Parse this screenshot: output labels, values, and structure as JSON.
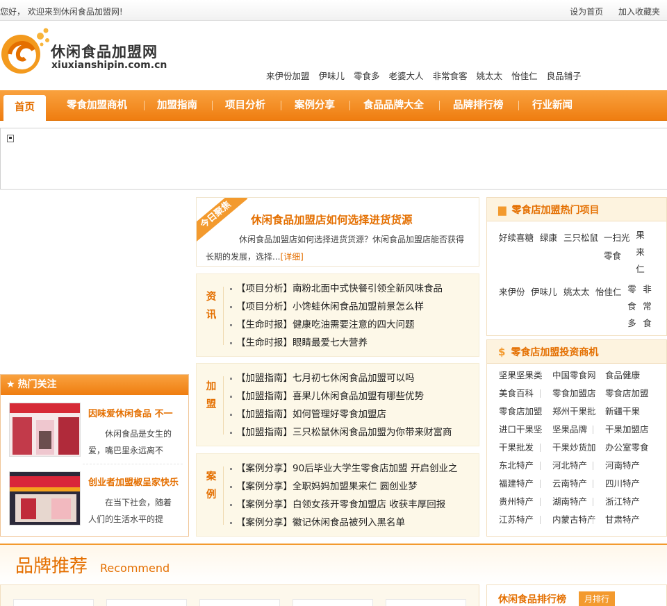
{
  "topbar": {
    "welcome": "您好， 欢迎来到休闲食品加盟网!",
    "set_home": "设为首页",
    "add_favorite": "加入收藏夹"
  },
  "logo": {
    "name": "休闲食品加盟网",
    "domain": "xiuxianshipin.com.cn"
  },
  "hot_brands": [
    "来伊份加盟",
    "伊味儿",
    "零食多",
    "老婆大人",
    "非常食客",
    "姚太太",
    "怡佳仁",
    "良品铺子"
  ],
  "nav": [
    "首页",
    "零食加盟商机",
    "加盟指南",
    "项目分析",
    "案例分享",
    "食品品牌大全",
    "品牌排行榜",
    "行业新闻"
  ],
  "focus": {
    "ribbon": "今日聚焦",
    "title": "休闲食品加盟店如何选择进货货源",
    "desc": "休闲食品加盟店如何选择进货货源？休闲食品加盟店能否获得长期的发展，选择...",
    "more": "[详细]"
  },
  "news_blocks": [
    {
      "category": "资讯",
      "items": [
        "【项目分析】南粉北面中式快餐引领全新风味食品",
        "【项目分析】小馋蛙休闲食品加盟前景怎么样",
        "【生命时报】健康吃油需要注意的四大问题",
        "【生命时报】眼睛最爱七大营养"
      ]
    },
    {
      "category": "加盟",
      "items": [
        "【加盟指南】七月初七休闲食品加盟可以吗",
        "【加盟指南】喜果儿休闲食品加盟有哪些优势",
        "【加盟指南】如何管理好零食加盟店",
        "【加盟指南】三只松鼠休闲食品加盟为你带来财富商"
      ]
    },
    {
      "category": "案例",
      "items": [
        "【案例分享】90后毕业大学生零食店加盟 开启创业之",
        "【案例分享】全职妈妈加盟果来仁 圆创业梦",
        "【案例分享】白领女孩开零食加盟店 收获丰厚回报",
        "【案例分享】徽记休闲食品被列入黑名单"
      ]
    }
  ],
  "hot_panel": {
    "title": "热门关注",
    "items": [
      {
        "title": "因味爱休闲食品 不一",
        "desc": "休闲食品是女生的爱，嘴巴里永远离不"
      },
      {
        "title": "创业者加盟椒呈家快乐",
        "desc": "在当下社会，随着人们的生活水平的提高..."
      }
    ]
  },
  "projects": {
    "title": "零食店加盟热门项目",
    "row1": [
      "好续喜糖",
      "绿康",
      "三只松鼠",
      "一扫光"
    ],
    "row1_sub": "零食",
    "row1_vertical": "果来仁",
    "row2": [
      "来伊份",
      "伊味儿",
      "姚太太",
      "怡佳仁"
    ],
    "row2_vertical_a": "零食多",
    "row2_vertical_b": "非常食"
  },
  "invest": {
    "title": "零食店加盟投资商机",
    "rows": [
      [
        "坚果坚果类",
        "中国零食网",
        "食品健康"
      ],
      [
        "美食百科",
        "零食加盟店",
        "零食店加盟"
      ],
      [
        "零食店加盟",
        "郑州干果批",
        "新疆干果"
      ],
      [
        "进口干果坚",
        "坚果品牌",
        "干果加盟店"
      ],
      [
        "干果批发",
        "干果炒货加",
        "办公室零食"
      ],
      [
        "东北特产",
        "河北特产",
        "河南特产"
      ],
      [
        "福建特产",
        "云南特产",
        "四川特产"
      ],
      [
        "贵州特产",
        "湖南特产",
        "浙江特产"
      ],
      [
        "江苏特产",
        "内蒙古特产",
        "甘肃特产"
      ]
    ]
  },
  "recommend": {
    "title_cn": "品牌推荐",
    "title_en": "Recommend"
  },
  "ranking": {
    "title": "休闲食品排行榜",
    "tab": "月排行"
  },
  "colors": {
    "accent": "#ef7d10",
    "accent_light": "#f9a23f",
    "title_orange": "#e46f00",
    "news_bg": "#fdf8e8"
  }
}
